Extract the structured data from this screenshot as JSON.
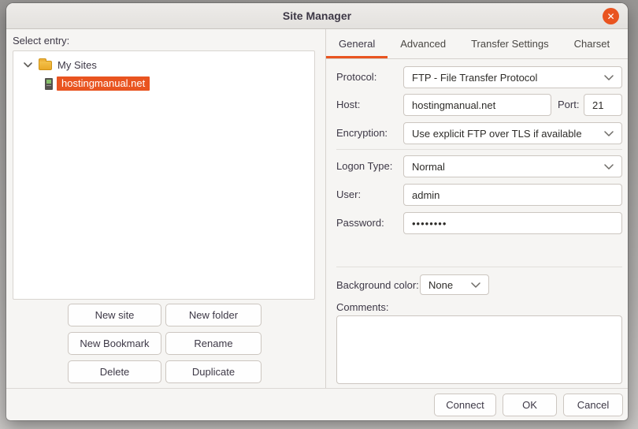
{
  "window": {
    "title": "Site Manager",
    "close_glyph": "✕"
  },
  "left_panel": {
    "label": "Select entry:",
    "tree": {
      "root_label": "My Sites",
      "site_label": "hostingmanual.net"
    },
    "buttons": {
      "new_site": "New site",
      "new_folder": "New folder",
      "new_bookmark": "New Bookmark",
      "rename": "Rename",
      "delete": "Delete",
      "duplicate": "Duplicate"
    }
  },
  "tabs": [
    {
      "label": "General",
      "active": true
    },
    {
      "label": "Advanced",
      "active": false
    },
    {
      "label": "Transfer Settings",
      "active": false
    },
    {
      "label": "Charset",
      "active": false
    }
  ],
  "form": {
    "protocol": {
      "label": "Protocol:",
      "value": "FTP - File Transfer Protocol"
    },
    "host": {
      "label": "Host:",
      "value": "hostingmanual.net"
    },
    "port": {
      "label": "Port:",
      "value": "21"
    },
    "encryption": {
      "label": "Encryption:",
      "value": "Use explicit FTP over TLS if available"
    },
    "logon_type": {
      "label": "Logon Type:",
      "value": "Normal"
    },
    "user": {
      "label": "User:",
      "value": "admin"
    },
    "password": {
      "label": "Password:",
      "value": "••••••••"
    },
    "background_color": {
      "label": "Background color:",
      "value": "None"
    },
    "comments": {
      "label": "Comments:",
      "value": ""
    }
  },
  "footer": {
    "connect": "Connect",
    "ok": "OK",
    "cancel": "Cancel"
  },
  "colors": {
    "accent": "#e95420",
    "selection_bg": "#e95420",
    "close_button_bg": "#e95420",
    "dialog_bg": "#f6f5f3"
  }
}
